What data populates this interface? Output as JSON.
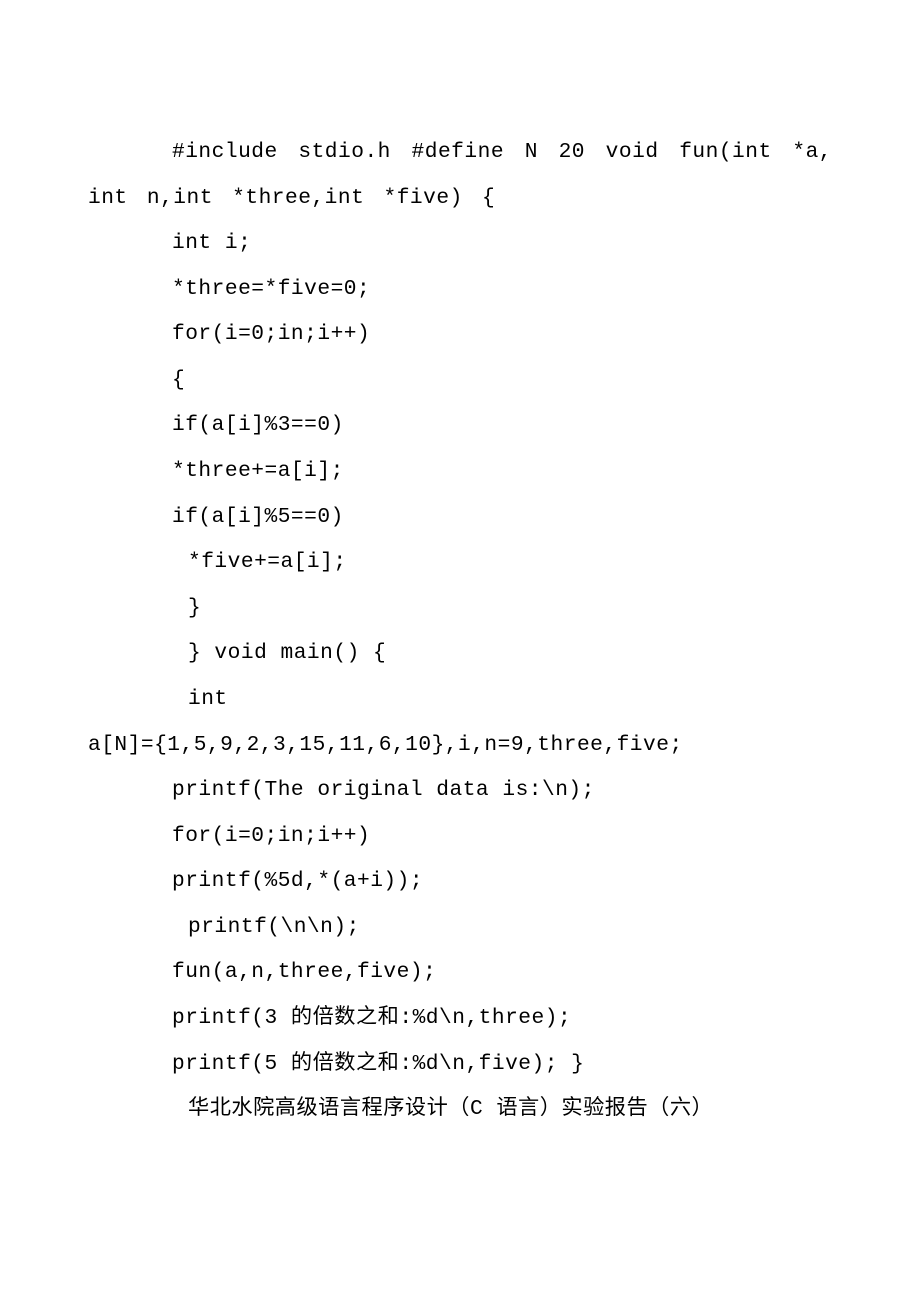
{
  "lines": [
    {
      "cls": "first-para",
      "text": "#include stdio.h #define N 20 void fun(int *a,int n,int *three,int *five) {"
    },
    {
      "cls": "indent1",
      "text": "int i;"
    },
    {
      "cls": "indent1",
      "text": "*three=*five=0;"
    },
    {
      "cls": "indent1",
      "text": "for(i=0;in;i++)"
    },
    {
      "cls": "indent1",
      "text": "{"
    },
    {
      "cls": "indent1",
      "text": "if(a[i]%3==0)"
    },
    {
      "cls": "indent1",
      "text": "*three+=a[i];"
    },
    {
      "cls": "indent1",
      "text": "if(a[i]%5==0)"
    },
    {
      "cls": "indent2",
      "text": "*five+=a[i];"
    },
    {
      "cls": "indent2",
      "text": "}"
    },
    {
      "cls": "indent2",
      "text": "} void main() {"
    },
    {
      "cls": "indent2",
      "text": "int "
    },
    {
      "cls": "noindent",
      "text": "a[N]={1,5,9,2,3,15,11,6,10},i,n=9,three,five;"
    },
    {
      "cls": "indent1",
      "text": "printf(The original data is:\\n);"
    },
    {
      "cls": "indent1",
      "text": "for(i=0;in;i++)"
    },
    {
      "cls": "indent1",
      "text": "printf(%5d,*(a+i));"
    },
    {
      "cls": "indent2",
      "text": "printf(\\n\\n);"
    },
    {
      "cls": "indent1",
      "text": "fun(a,n,three,five);"
    },
    {
      "cls": "indent1",
      "text": "printf(3 的倍数之和:%d\\n,three);"
    },
    {
      "cls": "indent1",
      "text": "printf(5 的倍数之和:%d\\n,five); }"
    },
    {
      "cls": "indent2",
      "text": "华北水院高级语言程序设计（C 语言）实验报告（六）"
    }
  ]
}
